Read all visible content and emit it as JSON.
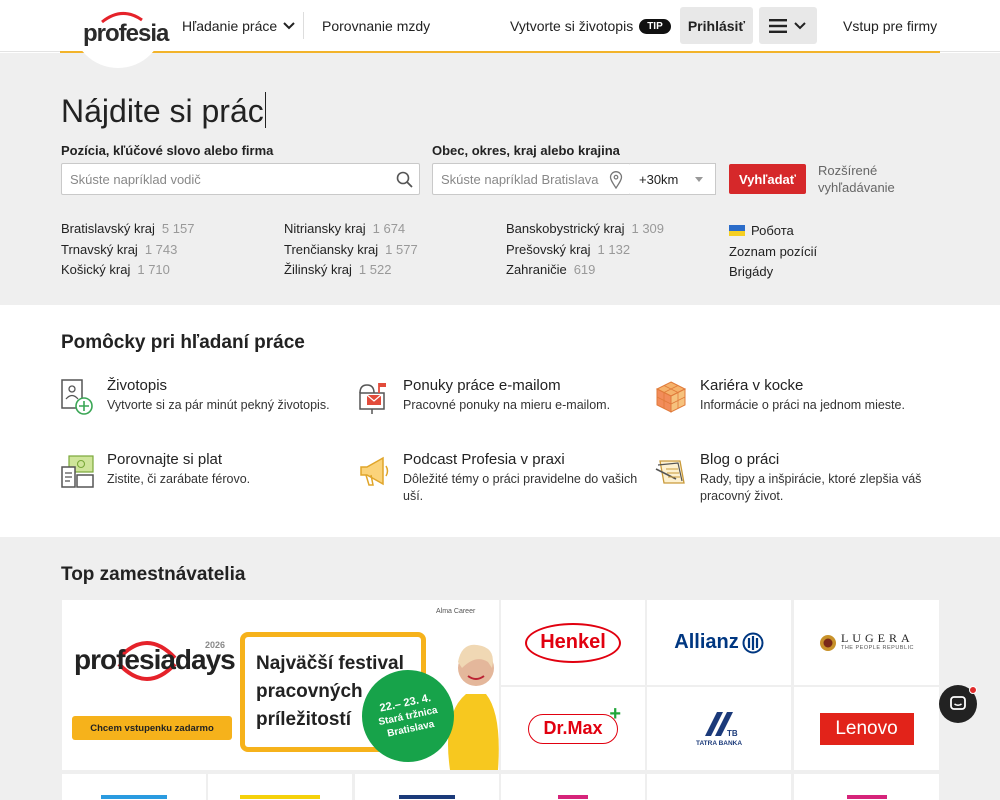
{
  "header": {
    "logo_text": "profesia",
    "nav_jobs": "Hľadanie práce",
    "nav_salary": "Porovnanie mzdy",
    "nav_cv": "Vytvorte si životopis",
    "tip_badge": "TIP",
    "login": "Prihlásiť",
    "companies": "Vstup pre firmy"
  },
  "search": {
    "title": "Nájdite si prác",
    "position_label": "Pozícia, kľúčové slovo alebo firma",
    "position_placeholder": "Skúste napríklad vodič",
    "location_label": "Obec, okres, kraj alebo krajina",
    "location_placeholder": "Skúste napríklad Bratislava",
    "radius": "+30km",
    "submit": "Vyhľadať",
    "advanced": "Rozšírené vyhľadávanie"
  },
  "regions": [
    [
      {
        "name": "Bratislavský kraj",
        "count": "5 157"
      },
      {
        "name": "Trnavský kraj",
        "count": "1 743"
      },
      {
        "name": "Košický kraj",
        "count": "1 710"
      }
    ],
    [
      {
        "name": "Nitriansky kraj",
        "count": "1 674"
      },
      {
        "name": "Trenčiansky kraj",
        "count": "1 577"
      },
      {
        "name": "Žilinský kraj",
        "count": "1 522"
      }
    ],
    [
      {
        "name": "Banskobystrický kraj",
        "count": "1 309"
      },
      {
        "name": "Prešovský kraj",
        "count": "1 132"
      },
      {
        "name": "Zahraničie",
        "count": "619"
      }
    ]
  ],
  "extra_links": {
    "ukraine": "Робота",
    "positions": "Zoznam pozícií",
    "brigady": "Brigády"
  },
  "tools": {
    "title": "Pomôcky pri hľadaní práce",
    "items": [
      {
        "name": "Životopis",
        "desc": "Vytvorte si za pár minút pekný životopis.",
        "icon": "cv-icon"
      },
      {
        "name": "Ponuky práce e-mailom",
        "desc": "Pracovné ponuky na mieru e-mailom.",
        "icon": "mailbox-icon"
      },
      {
        "name": "Kariéra v kocke",
        "desc": "Informácie o práci na jednom mieste.",
        "icon": "cube-icon"
      },
      {
        "name": "Porovnajte si plat",
        "desc": "Zistite, či zarábate férovo.",
        "icon": "salary-icon"
      },
      {
        "name": "Podcast Profesia v praxi",
        "desc": "Dôležité témy o práci pravidelne do vašich uší.",
        "icon": "megaphone-icon"
      },
      {
        "name": "Blog o práci",
        "desc": "Rady, tipy a inšpirácie, ktoré zlepšia váš pracovný život.",
        "icon": "blog-icon"
      }
    ]
  },
  "employers": {
    "title": "Top zamestnávatelia",
    "banner": {
      "brand": "profesiadays",
      "year": "2026",
      "powered": "Alma Career",
      "headline_1": "Najväčší festival",
      "headline_2": "pracovných",
      "headline_3": "príležitostí",
      "date": "22.– 23. 4.",
      "venue_1": "Stará tržnica",
      "venue_2": "Bratislava",
      "cta": "Chcem vstupenku zadarmo"
    },
    "logos": [
      "Henkel",
      "Allianz",
      "LUGERA",
      "Dr.Max",
      "TATRA BANKA",
      "Lenovo"
    ],
    "lugera_tagline": "THE PEOPLE REPUBLIC",
    "tatra_mark": "TB"
  },
  "colors": {
    "accent_red": "#d6282a",
    "accent_yellow": "#f2b32a",
    "bg_gray": "#efefef"
  }
}
